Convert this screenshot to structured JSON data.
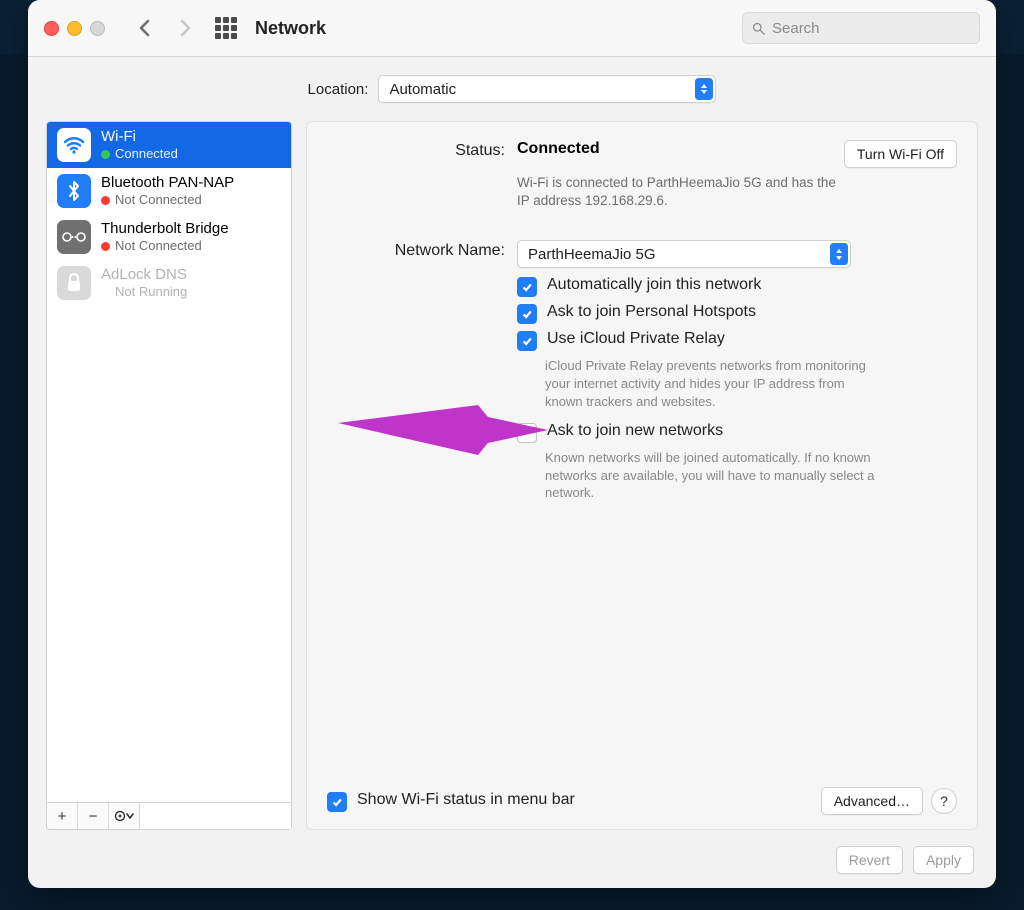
{
  "header": {
    "title": "Network",
    "search_placeholder": "Search"
  },
  "location": {
    "label": "Location:",
    "value": "Automatic"
  },
  "sidebar": {
    "items": [
      {
        "name": "Wi-Fi",
        "status": "Connected",
        "dot": "green",
        "sel": true
      },
      {
        "name": "Bluetooth PAN-NAP",
        "status": "Not Connected",
        "dot": "red"
      },
      {
        "name": "Thunderbolt Bridge",
        "status": "Not Connected",
        "dot": "red"
      },
      {
        "name": "AdLock DNS",
        "status": "Not Running",
        "dot": "",
        "dim": true
      }
    ],
    "tool_add": "+",
    "tool_remove": "−",
    "tool_more": "⊙﹀"
  },
  "panel": {
    "status_label": "Status:",
    "status_value": "Connected",
    "wifi_off_btn": "Turn Wi-Fi Off",
    "status_desc": "Wi-Fi is connected to ParthHeemaJio 5G and has the IP address 192.168.29.6.",
    "network_name_label": "Network Name:",
    "network_name_value": "ParthHeemaJio 5G",
    "cb_autojoin": "Automatically join this network",
    "cb_hotspot": "Ask to join Personal Hotspots",
    "cb_relay": "Use iCloud Private Relay",
    "relay_desc": "iCloud Private Relay prevents networks from monitoring your internet activity and hides your IP address from known trackers and websites.",
    "cb_newnet": "Ask to join new networks",
    "newnet_desc": "Known networks will be joined automatically. If no known networks are available, you will have to manually select a network.",
    "cb_menubar": "Show Wi-Fi status in menu bar",
    "advanced_btn": "Advanced…",
    "help": "?"
  },
  "footer": {
    "revert": "Revert",
    "apply": "Apply"
  }
}
